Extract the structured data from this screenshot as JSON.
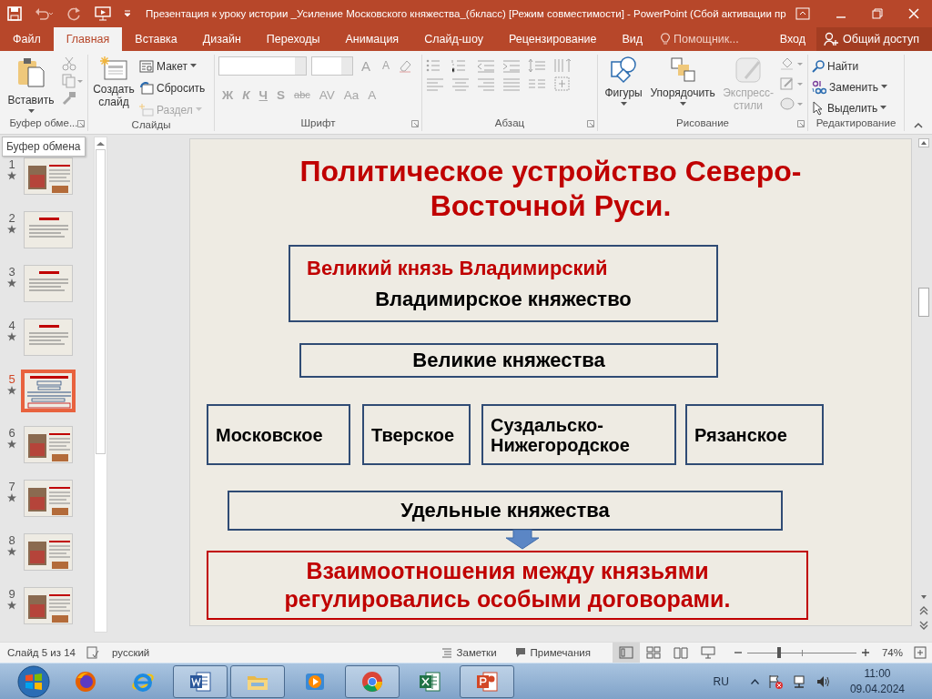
{
  "title_bar": {
    "title": "Презентация к уроку истории _Усиление Московского княжества_(бкласс) [Режим совместимости] - PowerPoint (Сбой активации пр"
  },
  "tabs": [
    {
      "label": "Файл",
      "selected": false
    },
    {
      "label": "Главная",
      "selected": true
    },
    {
      "label": "Вставка",
      "selected": false
    },
    {
      "label": "Дизайн",
      "selected": false
    },
    {
      "label": "Переходы",
      "selected": false
    },
    {
      "label": "Анимация",
      "selected": false
    },
    {
      "label": "Слайд-шоу",
      "selected": false
    },
    {
      "label": "Рецензирование",
      "selected": false
    },
    {
      "label": "Вид",
      "selected": false
    }
  ],
  "tell_me": "Помощник...",
  "sign_in": "Вход",
  "share": "Общий доступ",
  "ribbon": {
    "clipboard": {
      "label": "Буфер обме...",
      "paste": "Вставить"
    },
    "slides": {
      "label": "Слайды",
      "new_slide": "Создать слайд",
      "layout": "Макет",
      "reset": "Сбросить",
      "section": {
        "label": "Раздел",
        "disabled": true
      }
    },
    "font": {
      "label": "Шрифт",
      "grow": "A",
      "shrink": "A",
      "format_buttons": [
        "Ж",
        "К",
        "Ч",
        "S",
        "abc",
        "AV",
        "Aa",
        "A"
      ]
    },
    "paragraph": {
      "label": "Абзац"
    },
    "drawing": {
      "label": "Рисование",
      "shapes": "Фигуры",
      "arrange": "Упорядочить",
      "quick_styles": {
        "label": "Экспресс-стили",
        "disabled": true
      }
    },
    "editing": {
      "label": "Редактирование",
      "find": "Найти",
      "replace": "Заменить",
      "select": "Выделить"
    }
  },
  "tooltip": "Буфер обмена",
  "slides_panel": [
    {
      "number": "1",
      "kind": "photo",
      "selected": false
    },
    {
      "number": "2",
      "kind": "text",
      "selected": false
    },
    {
      "number": "3",
      "kind": "text",
      "selected": false
    },
    {
      "number": "4",
      "kind": "text",
      "selected": false
    },
    {
      "number": "5",
      "kind": "diagram",
      "selected": true
    },
    {
      "number": "6",
      "kind": "photo",
      "selected": false
    },
    {
      "number": "7",
      "kind": "photo",
      "selected": false
    },
    {
      "number": "8",
      "kind": "photo",
      "selected": false
    },
    {
      "number": "9",
      "kind": "photo",
      "selected": false
    }
  ],
  "slide": {
    "title": "Политическое устройство Северо-Восточной Руси.",
    "boxes": [
      {
        "kind": "top",
        "heading": "Великий князь Владимирский",
        "text": "Владимирское княжество"
      },
      {
        "kind": "wide",
        "text": "Великие княжества"
      },
      {
        "kind": "small",
        "text": "Московское"
      },
      {
        "kind": "small",
        "text": "Тверское"
      },
      {
        "kind": "small",
        "text": "Суздальско-Нижегородское"
      },
      {
        "kind": "small",
        "text": "Рязанское"
      },
      {
        "kind": "wide",
        "text": "Удельные княжества"
      },
      {
        "kind": "conclusion",
        "text": "Взаимоотношения между князьями регулировались особыми договорами."
      }
    ]
  },
  "status_bar": {
    "slide_counter": "Слайд 5 из 14",
    "language": "русский",
    "notes": "Заметки",
    "comments": "Примечания",
    "views": [
      {
        "kind": "normal",
        "selected": true
      },
      {
        "kind": "sorter",
        "selected": false
      },
      {
        "kind": "reading",
        "selected": false
      },
      {
        "kind": "slideshow",
        "selected": false
      }
    ],
    "zoom": {
      "level": 0.29,
      "reading": "74%"
    }
  },
  "taskbar": {
    "apps": [
      {
        "kind": "firefox",
        "running": false
      },
      {
        "kind": "ie",
        "running": false
      },
      {
        "kind": "word",
        "running": true
      },
      {
        "kind": "explorer",
        "running": true
      },
      {
        "kind": "media",
        "running": false
      },
      {
        "kind": "chrome",
        "running": true
      },
      {
        "kind": "excel",
        "running": false
      },
      {
        "kind": "powerpoint",
        "running": true
      }
    ],
    "language": "RU",
    "time": "11:00",
    "date": "09.04.2024"
  }
}
